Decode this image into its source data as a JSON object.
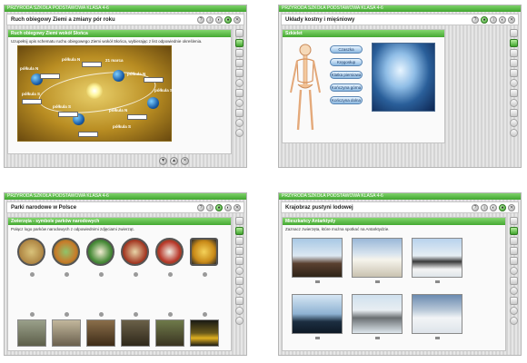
{
  "app_title": "PRZYRODA SZKOŁA PODSTAWOWA KLASA 4-6",
  "panels": [
    {
      "title": "Ruch obiegowy Ziemi a zmiany pór roku",
      "section_title": "Ruch obiegowy Ziemi wokół Słońca",
      "description": "Uzupełnij opis schematu ruchu obiegowego Ziemi wokół Słońca, wybierając z list odpowiednie określenia.",
      "diagram_labels": [
        "21 marca",
        "półkula N",
        "półkula N",
        "półkula N",
        "półkula N",
        "półkula S",
        "półkula S",
        "półkula S",
        "półkula S"
      ]
    },
    {
      "title": "Układy kostny i mięśniowy",
      "section_title": "Szkielet",
      "organ_buttons": [
        "Czaszka",
        "Kręgosłup",
        "Klatka piersiowa",
        "Kończyna górna",
        "Kończyna dolna"
      ]
    },
    {
      "title": "Parki narodowe w Polsce",
      "section_title": "Zwierzęta - symbole parków narodowych",
      "description": "Połącz logo parków narodowych z odpowiednimi zdjęciami zwierząt."
    },
    {
      "title": "Krajobraz pustyni lodowej",
      "section_title": "Mieszkańcy Antarktydy",
      "description": "Zaznacz zwierzęta, które można spotkać na Antarktydzie."
    }
  ],
  "title_buttons": [
    "?",
    "i",
    "◐",
    "●",
    "✕"
  ],
  "nav_buttons": [
    "▼",
    "▲",
    "✕"
  ],
  "colors": {
    "accent_green": "#45a932",
    "panel_bg": "#e0e0e0",
    "content_bg": "#fafafa"
  }
}
